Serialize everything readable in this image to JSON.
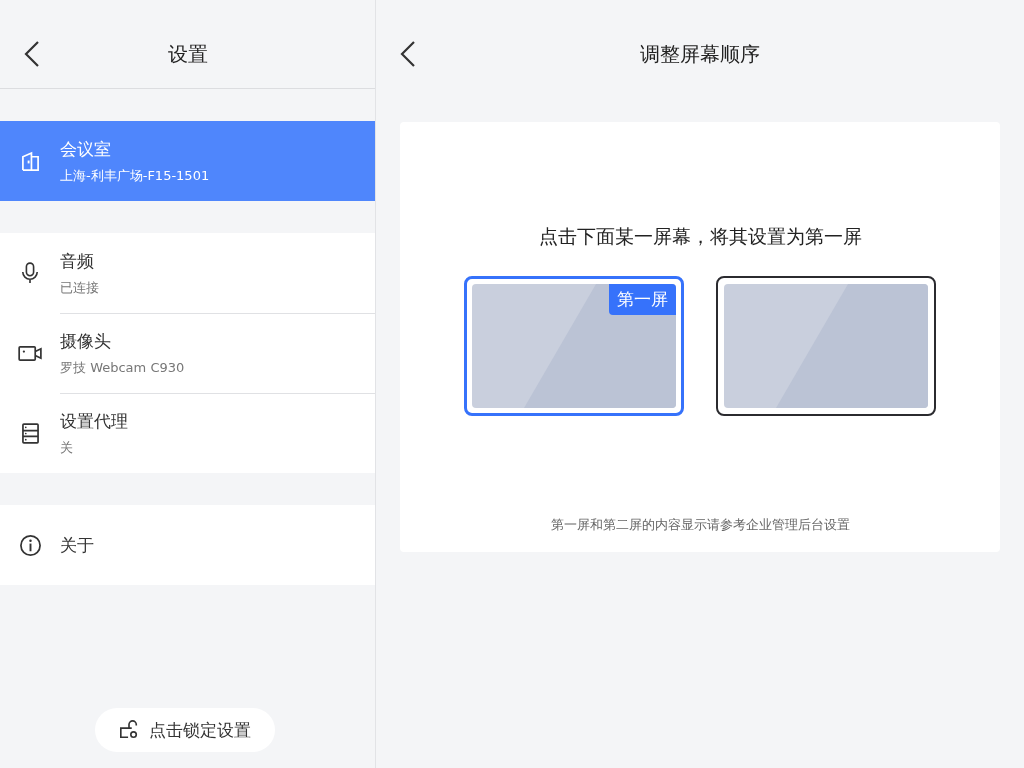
{
  "sidebar": {
    "title": "设置",
    "groups": [
      [
        {
          "kind": "door",
          "label": "会议室",
          "subtitle": "上海-利丰广场-F15-1501",
          "selected": true
        }
      ],
      [
        {
          "kind": "mic",
          "label": "音频",
          "subtitle": "已连接",
          "selected": false
        },
        {
          "kind": "camera",
          "label": "摄像头",
          "subtitle": "罗技 Webcam C930",
          "selected": false
        },
        {
          "kind": "server",
          "label": "设置代理",
          "subtitle": "关",
          "selected": false
        }
      ],
      [
        {
          "kind": "info",
          "label": "关于",
          "selected": false
        }
      ]
    ],
    "lock_button": "点击锁定设置"
  },
  "main": {
    "title": "调整屏幕顺序",
    "instruction": "点击下面某一屏幕，将其设置为第一屏",
    "screens": [
      {
        "selected": true,
        "badge": "第一屏"
      },
      {
        "selected": false
      }
    ],
    "footnote": "第一屏和第二屏的内容显示请参考企业管理后台设置"
  }
}
